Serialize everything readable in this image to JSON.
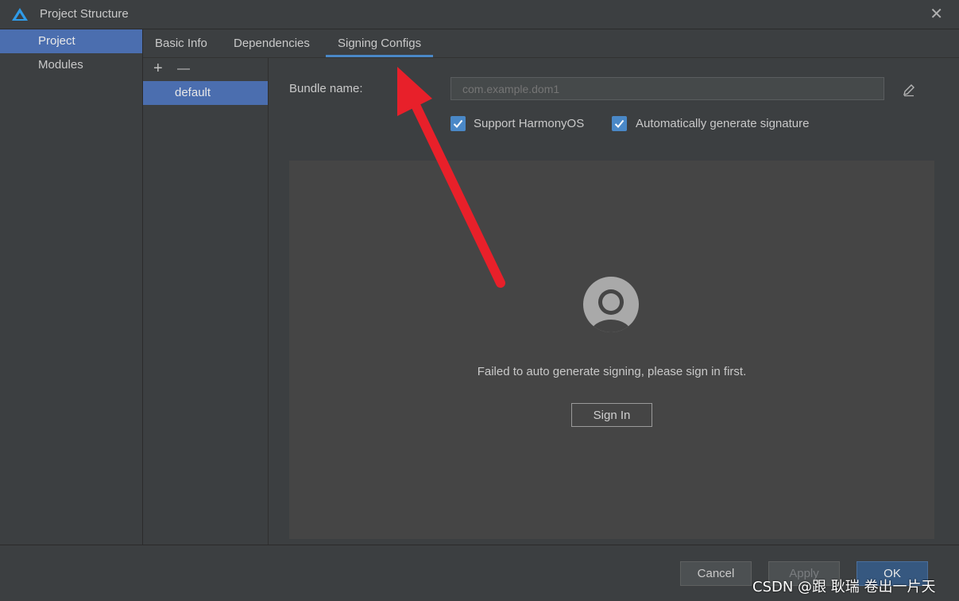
{
  "window": {
    "title": "Project Structure",
    "close_glyph": "✕",
    "logo_icon": "app-logo-icon"
  },
  "nav": {
    "items": [
      {
        "label": "Project",
        "selected": true
      },
      {
        "label": "Modules",
        "selected": false
      }
    ]
  },
  "tabs": [
    {
      "label": "Basic Info",
      "active": false
    },
    {
      "label": "Dependencies",
      "active": false
    },
    {
      "label": "Signing Configs",
      "active": true
    }
  ],
  "config_list": {
    "add_glyph": "+",
    "remove_glyph": "—",
    "items": [
      "default"
    ]
  },
  "signing": {
    "bundle_label": "Bundle name:",
    "bundle_placeholder": "com.example.dom1",
    "support_harmonyos": {
      "label": "Support HarmonyOS",
      "checked": true
    },
    "auto_generate": {
      "label": "Automatically generate signature",
      "checked": true
    },
    "fail_message": "Failed to auto generate signing, please sign in first.",
    "sign_in_label": "Sign In"
  },
  "footer": {
    "cancel_label": "Cancel",
    "apply_label": "Apply",
    "ok_label": "OK"
  },
  "watermark": "CSDN @跟 耿瑞 卷出一片天",
  "colors": {
    "accent": "#4b6eaf",
    "tab_underline": "#4a88c7",
    "annotation_arrow": "#e8202a"
  }
}
